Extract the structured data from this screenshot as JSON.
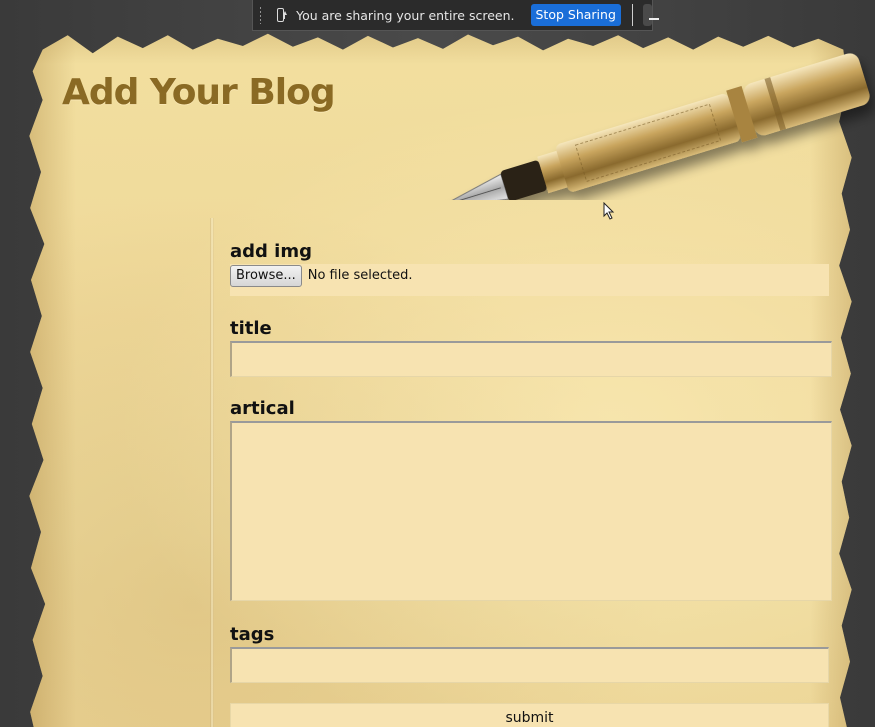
{
  "share_bar": {
    "icon": "share-screen-icon",
    "message": "You are sharing your entire screen.",
    "stop_label": "Stop Sharing",
    "minimize_icon": "minimize-icon"
  },
  "page": {
    "title": "Add Your Blog"
  },
  "form": {
    "image": {
      "label": "add img",
      "browse_label": "Browse...",
      "status": "No file selected."
    },
    "title": {
      "label": "title",
      "value": ""
    },
    "article": {
      "label": "artical",
      "value": ""
    },
    "tags": {
      "label": "tags",
      "value": ""
    },
    "submit_label": "submit"
  },
  "colors": {
    "parchment": "#f0dc9c",
    "title": "#8a6a24",
    "field_bg": "#f7e3b1",
    "stop_button": "#1a6ed8"
  }
}
